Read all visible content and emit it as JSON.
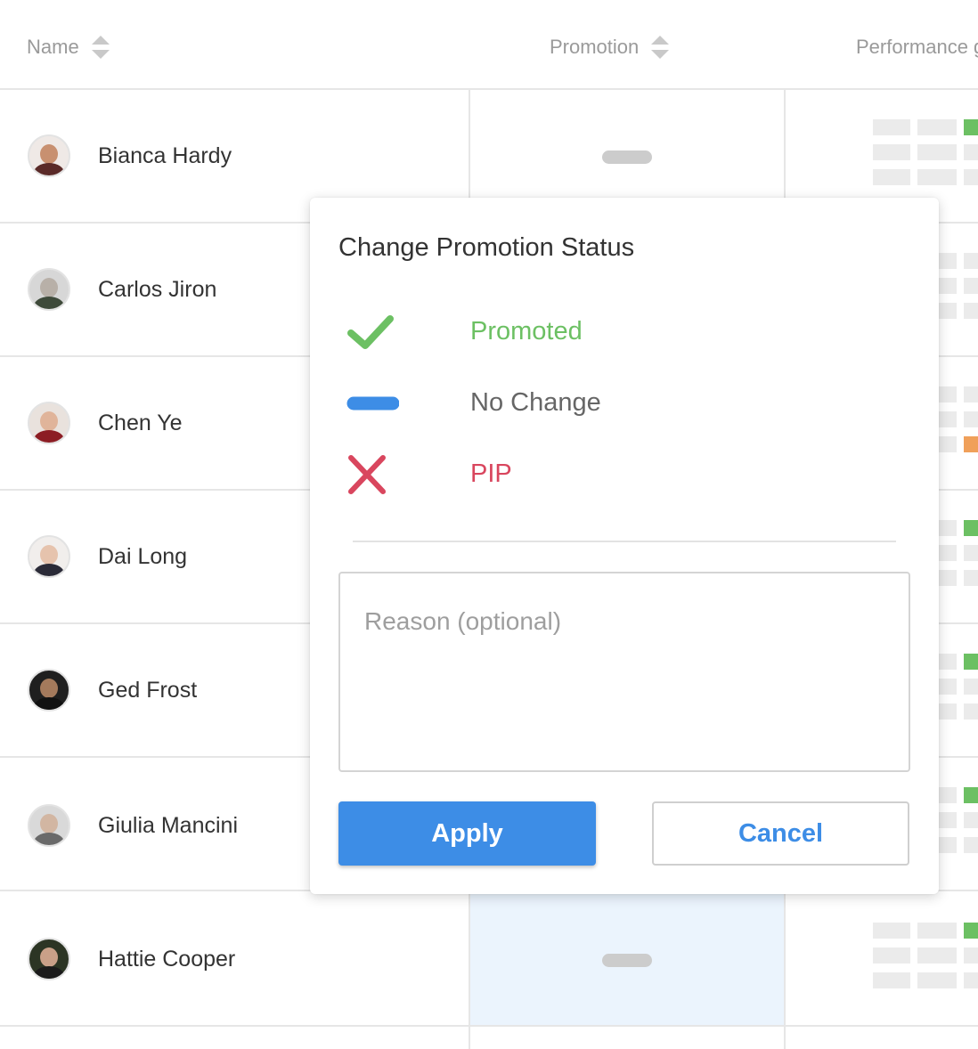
{
  "table": {
    "columns": [
      {
        "label": "Name"
      },
      {
        "label": "Promotion"
      },
      {
        "label": "Performance g"
      }
    ],
    "rows": [
      {
        "name": "Bianca Hardy"
      },
      {
        "name": "Carlos Jiron"
      },
      {
        "name": "Chen Ye"
      },
      {
        "name": "Dai Long"
      },
      {
        "name": "Ged Frost"
      },
      {
        "name": "Giulia Mancini"
      },
      {
        "name": "Hattie Cooper"
      }
    ]
  },
  "modal": {
    "title": "Change Promotion Status",
    "options": [
      {
        "label": "Promoted",
        "icon": "check-icon",
        "color": "#6cc063"
      },
      {
        "label": "No Change",
        "icon": "dash-icon",
        "color": "#3d8de6"
      },
      {
        "label": "PIP",
        "icon": "x-icon",
        "color": "#d9465e"
      }
    ],
    "reason_placeholder": "Reason (optional)",
    "apply_label": "Apply",
    "cancel_label": "Cancel"
  },
  "colors": {
    "accent": "#3d8de6",
    "success": "#6cc063",
    "danger": "#d9465e",
    "warning": "#f0a05a",
    "highlight_bg": "#ebf4fd"
  }
}
